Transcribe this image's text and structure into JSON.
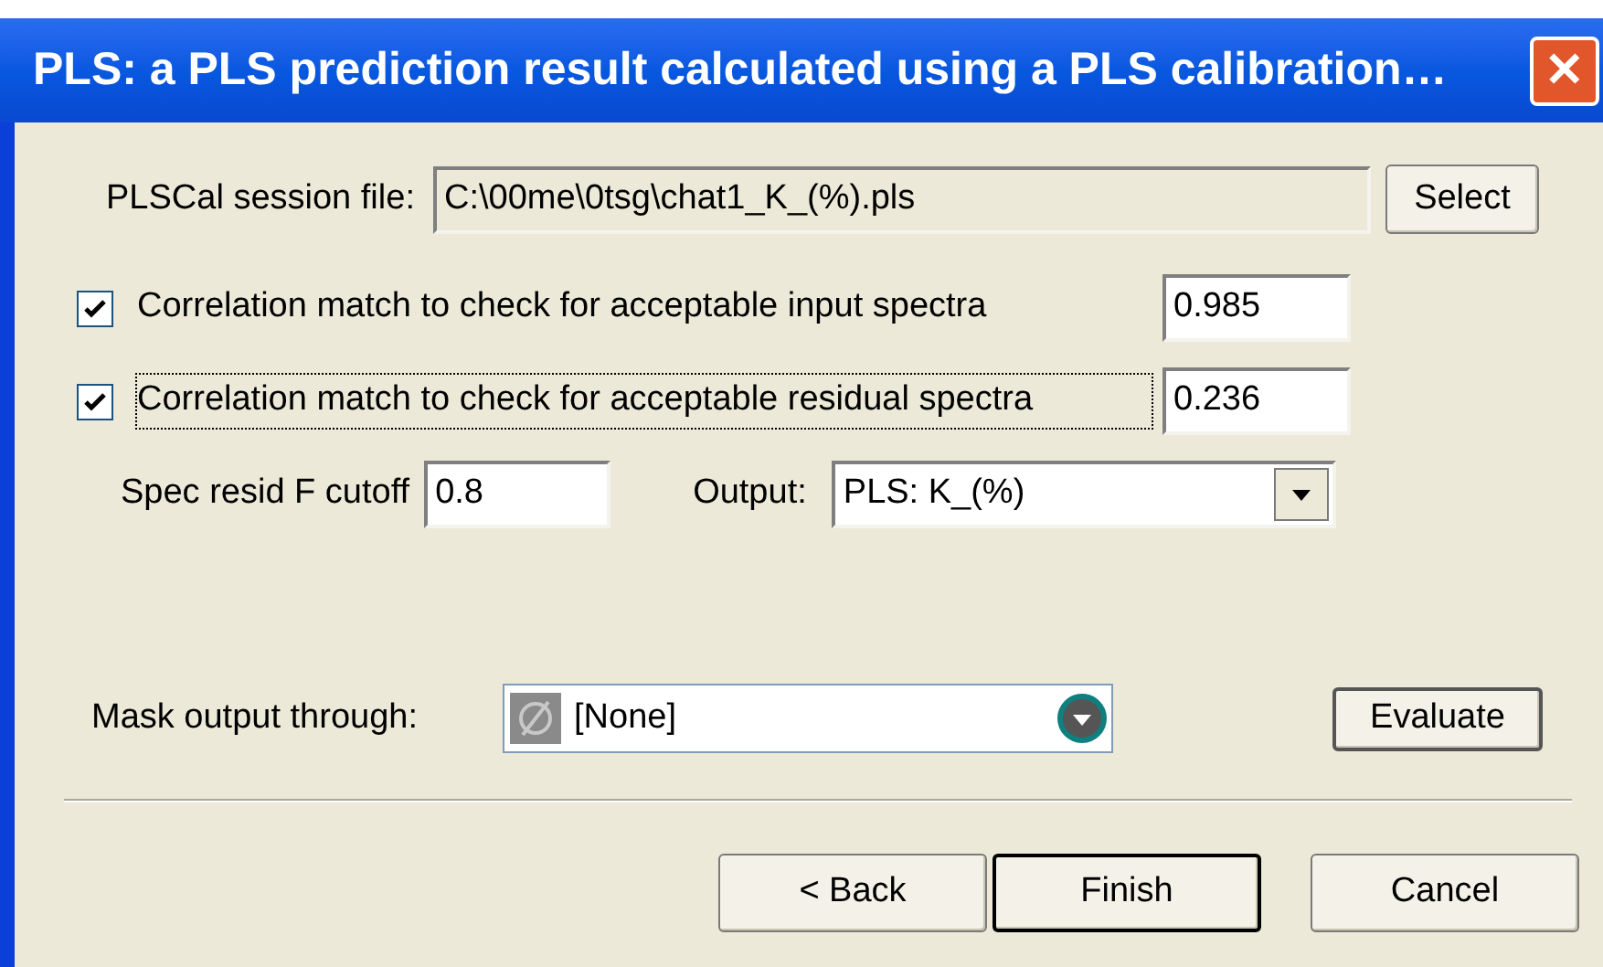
{
  "window": {
    "title": "PLS:  a PLS prediction result calculated using a PLS calibration…",
    "close": "✕"
  },
  "session_file": {
    "label": "PLSCal session file:",
    "value": "C:\\00me\\0tsg\\chat1_K_(%).pls",
    "button": "Select"
  },
  "checks": [
    {
      "label": "Correlation match to check for acceptable input spectra",
      "checked": true,
      "focused": false,
      "value": "0.985"
    },
    {
      "label": "Correlation match to check for acceptable residual spectra",
      "checked": true,
      "focused": true,
      "value": "0.236"
    }
  ],
  "cutoff": {
    "label": "Spec resid F cutoff",
    "value": "0.8"
  },
  "output": {
    "label": "Output:",
    "value": "PLS: K_(%)"
  },
  "mask": {
    "label": "Mask output through:",
    "value": "[None]"
  },
  "evaluate": "Evaluate",
  "buttons": [
    {
      "label": "< Back",
      "default": false
    },
    {
      "label": "Finish",
      "default": true
    },
    {
      "label": "Cancel",
      "default": false
    }
  ]
}
